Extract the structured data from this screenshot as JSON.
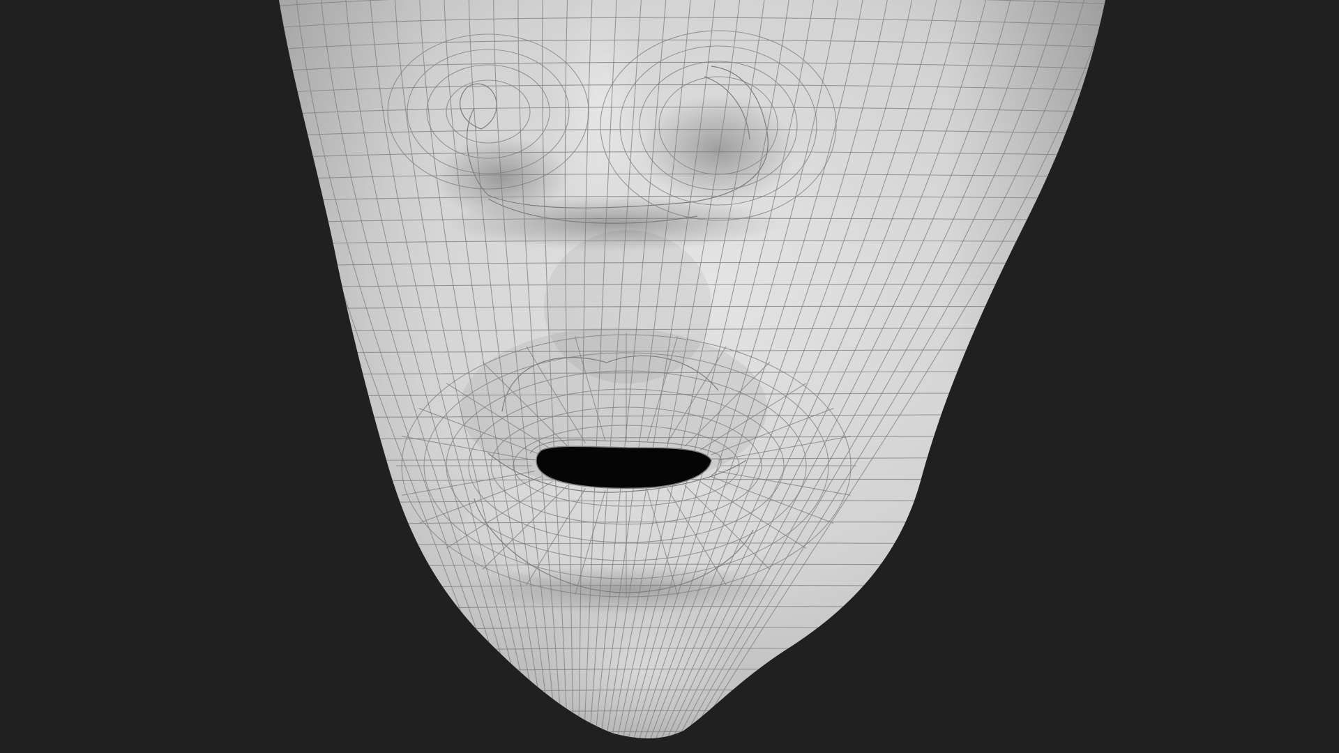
{
  "viewport": {
    "background_color": "#202020",
    "model_surface_color": "#d6d6d6",
    "wireframe_color": "#7d7d7d",
    "mouth_cavity_color": "#050505"
  },
  "model": {
    "subject": "face-mesh-lower-half",
    "features": [
      "nose-icon",
      "mouth-icon",
      "chin-icon"
    ]
  }
}
